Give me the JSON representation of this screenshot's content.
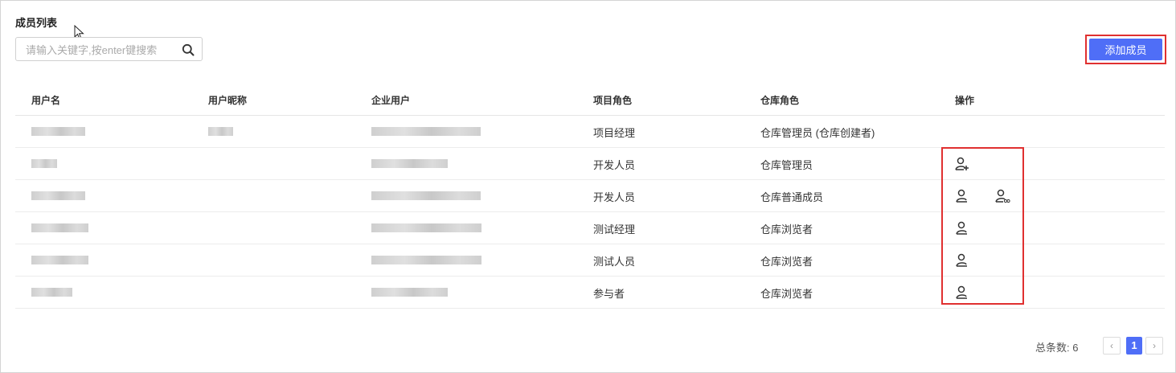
{
  "page": {
    "title": "成员列表"
  },
  "search": {
    "placeholder": "请输入关键字,按enter键搜索",
    "icon": "search-icon"
  },
  "toolbar": {
    "add_label": "添加成员",
    "accent": "#4f6ef7"
  },
  "table": {
    "headers": [
      "用户名",
      "用户昵称",
      "企业用户",
      "项目角色",
      "仓库角色",
      "操作"
    ],
    "rows": [
      {
        "project_role": "项目经理",
        "repo_role": "仓库管理员 (仓库创建者)"
      },
      {
        "project_role": "开发人员",
        "repo_role": "仓库管理员"
      },
      {
        "project_role": "开发人员",
        "repo_role": "仓库普通成员"
      },
      {
        "project_role": "测试经理",
        "repo_role": "仓库浏览者"
      },
      {
        "project_role": "测试人员",
        "repo_role": "仓库浏览者"
      },
      {
        "project_role": "参与者",
        "repo_role": "仓库浏览者"
      }
    ]
  },
  "pagination": {
    "total_label": "总条数: 6",
    "current_page": "1",
    "prev": "‹",
    "next": "›"
  }
}
